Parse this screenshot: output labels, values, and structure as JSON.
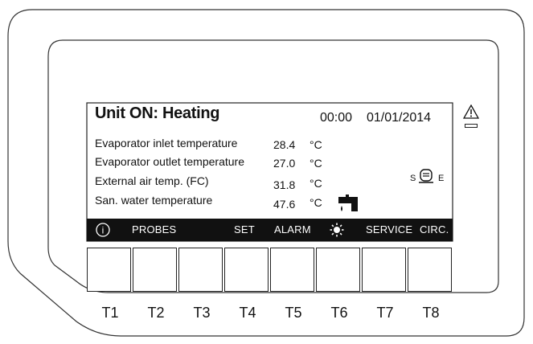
{
  "header": {
    "title": "Unit ON: Heating",
    "time": "00:00",
    "date": "01/01/2014"
  },
  "readings": [
    {
      "label": "Evaporator inlet temperature",
      "value": "28.4",
      "unit": "°C"
    },
    {
      "label": "Evaporator outlet temperature",
      "value": "27.0",
      "unit": "°C"
    },
    {
      "label": "External air temp. (FC)",
      "value": "31.8",
      "unit": "°C"
    },
    {
      "label": "San. water temperature",
      "value": "47.6",
      "unit": "°C"
    }
  ],
  "menu": {
    "info": "i",
    "probes": "PROBES",
    "set": "SET",
    "alarm": "ALARM",
    "service": "SERVICE",
    "circ": "CIRC."
  },
  "status": {
    "s_label": "S",
    "e_label": "E",
    "tap_icon": "water-tap-icon",
    "sun_icon": "sun-icon",
    "warning_icon": "warning-triangle-icon"
  },
  "keys": [
    "T1",
    "T2",
    "T3",
    "T4",
    "T5",
    "T6",
    "T7",
    "T8"
  ]
}
